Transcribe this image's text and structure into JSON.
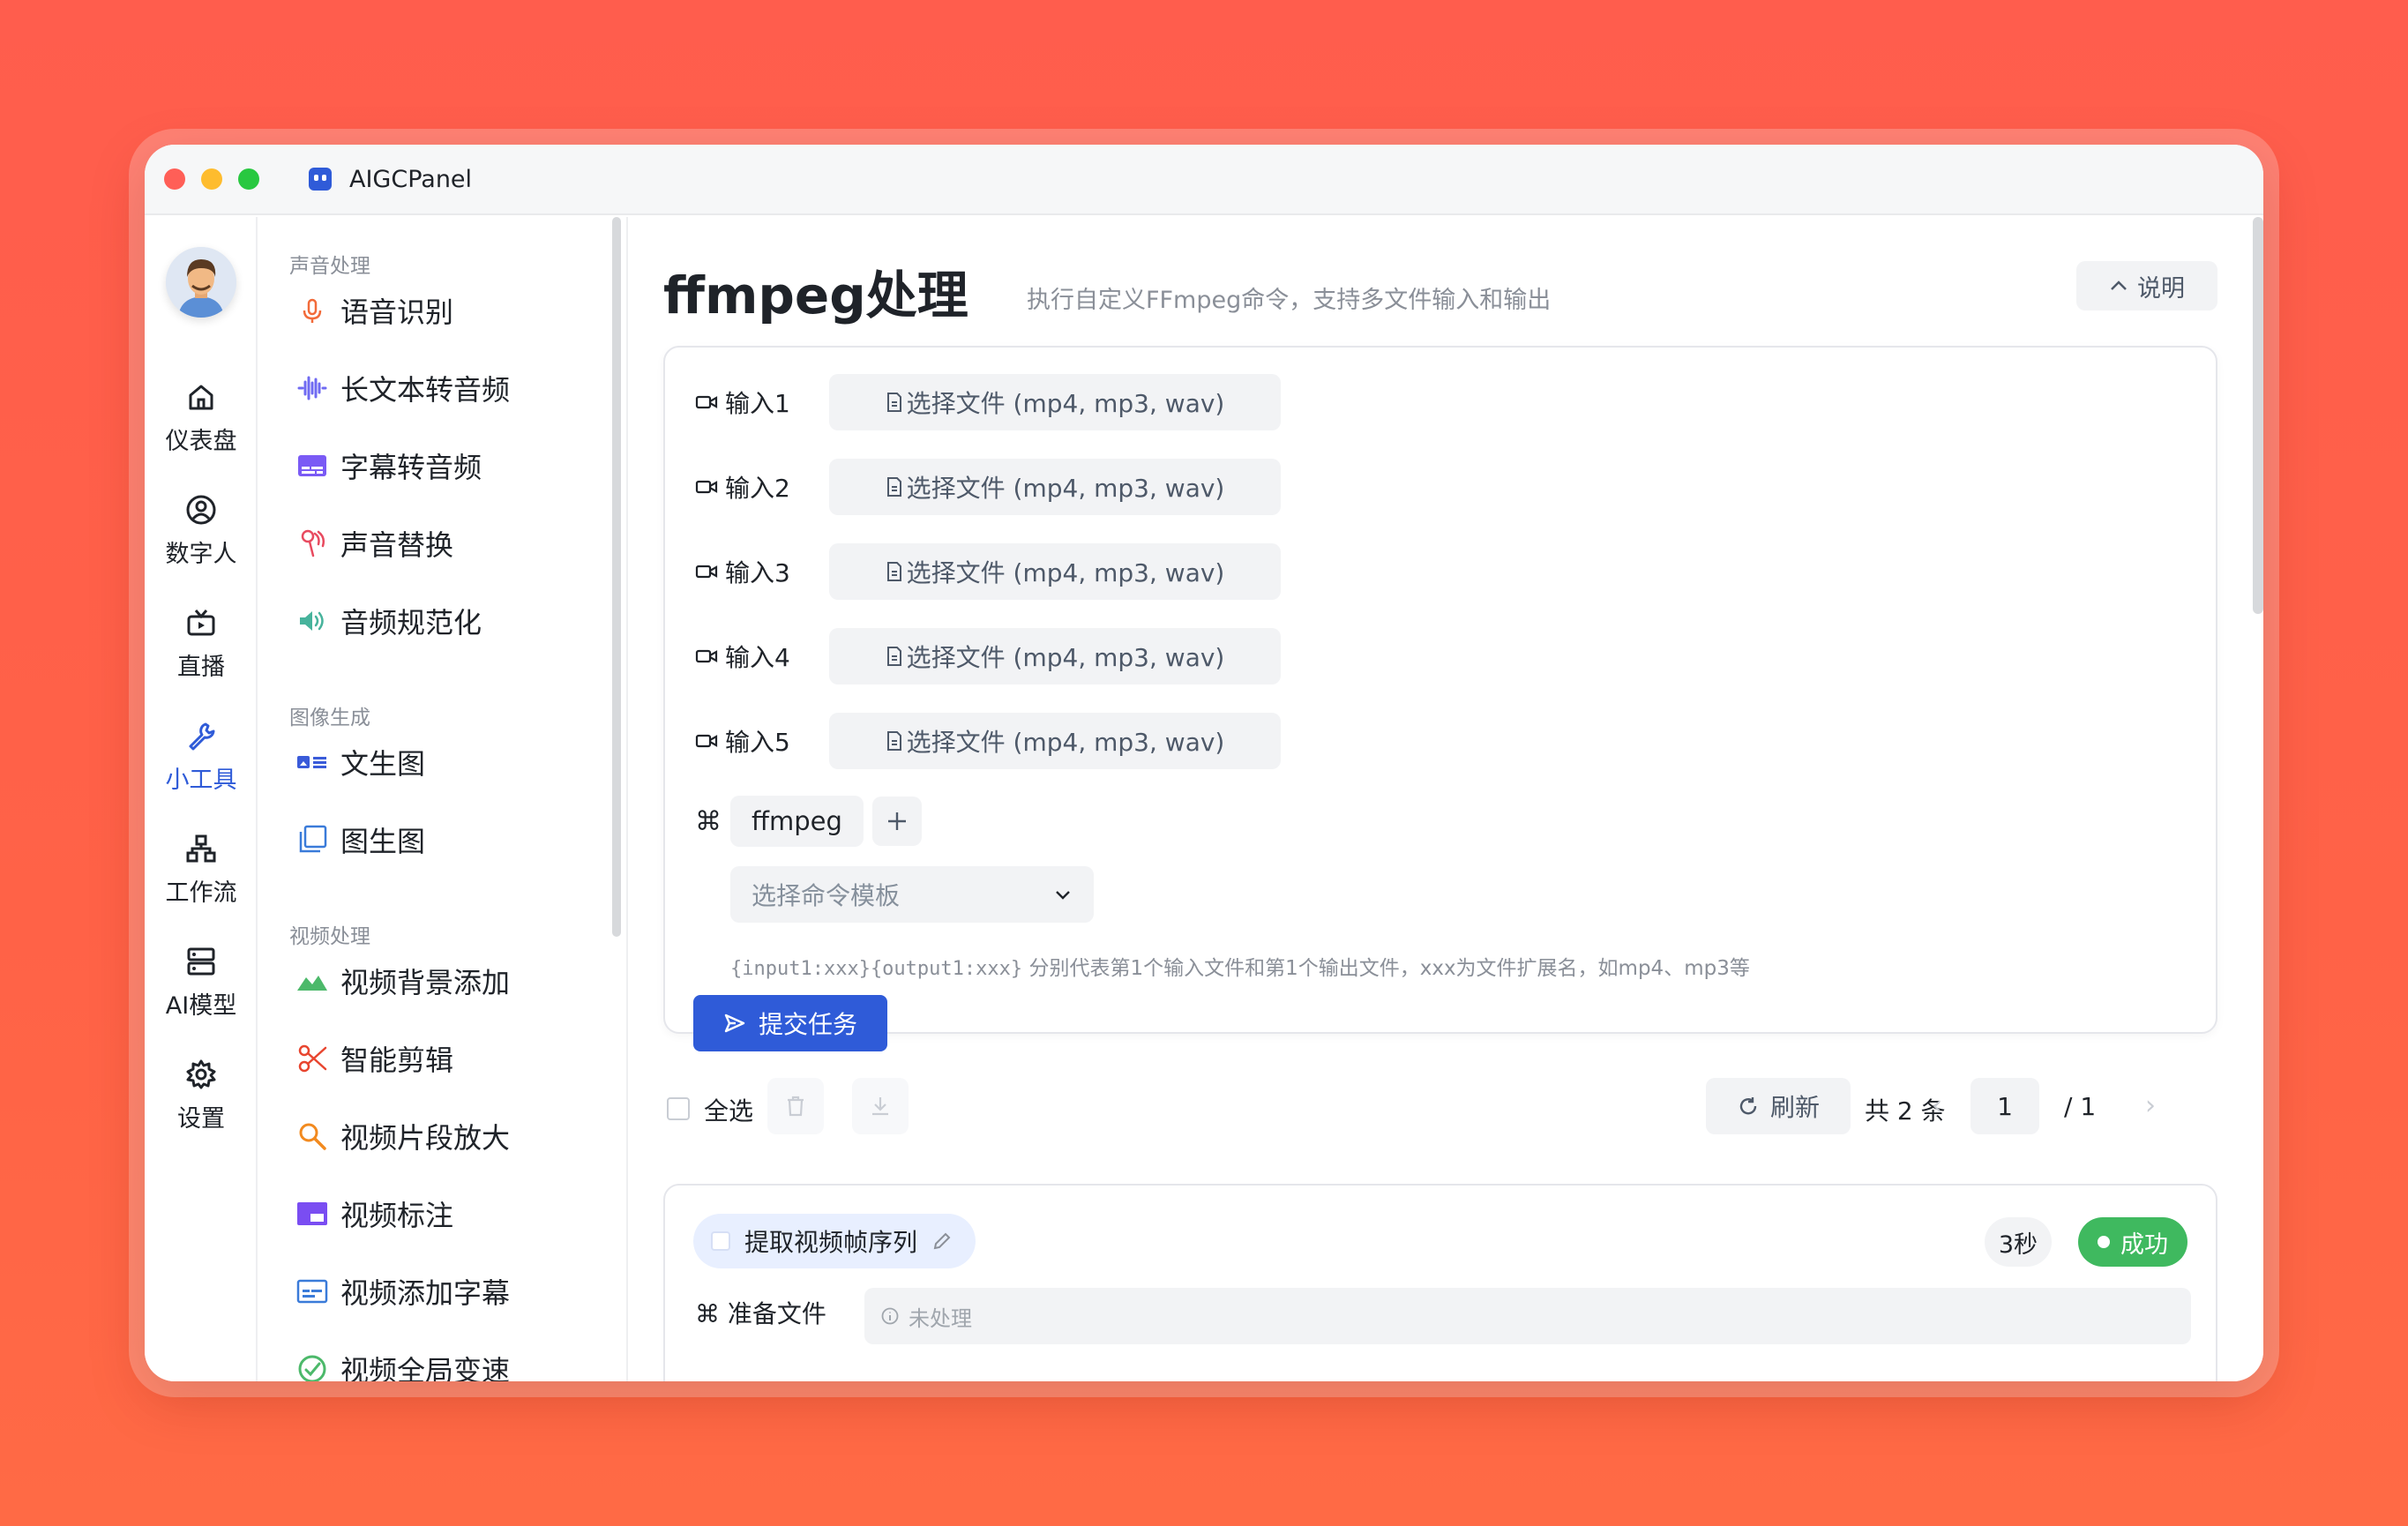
{
  "app": {
    "title": "AIGCPanel"
  },
  "rail": {
    "items": [
      {
        "label": "仪表盘"
      },
      {
        "label": "数字人"
      },
      {
        "label": "直播"
      },
      {
        "label": "小工具"
      },
      {
        "label": "工作流"
      },
      {
        "label": "AI模型"
      },
      {
        "label": "设置"
      }
    ],
    "active_index": 3
  },
  "menu": {
    "groups": [
      {
        "label": "声音处理",
        "items": [
          "语音识别",
          "长文本转音频",
          "字幕转音频",
          "声音替换",
          "音频规范化"
        ]
      },
      {
        "label": "图像生成",
        "items": [
          "文生图",
          "图生图"
        ]
      },
      {
        "label": "视频处理",
        "items": [
          "视频背景添加",
          "智能剪辑",
          "视频片段放大",
          "视频标注",
          "视频添加字幕",
          "视频全局变速"
        ]
      }
    ]
  },
  "page": {
    "title": "ffmpeg处理",
    "description": "执行自定义FFmpeg命令，支持多文件输入和输出",
    "help_label": "说明"
  },
  "form": {
    "inputs": [
      {
        "label": "输入1",
        "button": "选择文件 (mp4, mp3, wav)"
      },
      {
        "label": "输入2",
        "button": "选择文件 (mp4, mp3, wav)"
      },
      {
        "label": "输入3",
        "button": "选择文件 (mp4, mp3, wav)"
      },
      {
        "label": "输入4",
        "button": "选择文件 (mp4, mp3, wav)"
      },
      {
        "label": "输入5",
        "button": "选择文件 (mp4, mp3, wav)"
      }
    ],
    "command_symbol": "⌘",
    "command_chip": "ffmpeg",
    "template_placeholder": "选择命令模板",
    "hint_code": "{input1:xxx}{output1:xxx}",
    "hint_text": " 分别代表第1个输入文件和第1个输出文件，xxx为文件扩展名，如mp4、mp3等",
    "submit_label": "提交任务"
  },
  "toolbar": {
    "select_all": "全选",
    "refresh": "刷新",
    "total": "共 2 条",
    "page_current": "1",
    "page_total": "/  1"
  },
  "task": {
    "title": "提取视频帧序列",
    "duration": "3秒",
    "status": "成功",
    "status_color": "#3fb95f",
    "prep_label": "⌘ 准备文件",
    "prep_value": "未处理"
  },
  "colors": {
    "accent": "#2f5bd8",
    "background": "#ff5d4d"
  }
}
